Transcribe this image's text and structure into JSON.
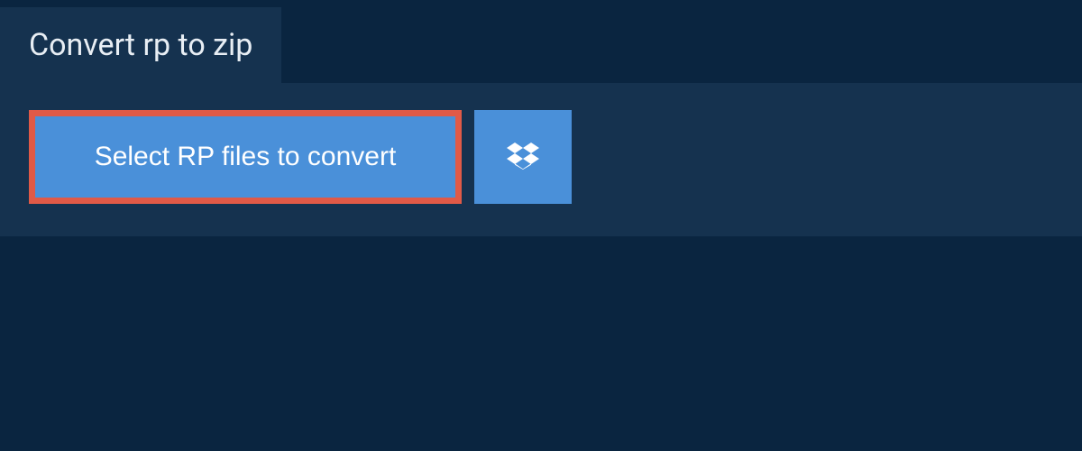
{
  "header": {
    "title": "Convert rp to zip"
  },
  "actions": {
    "select_files_label": "Select RP files to convert",
    "dropbox_icon": "dropbox-icon"
  },
  "colors": {
    "page_bg": "#0a2540",
    "panel_bg": "#15324f",
    "button_bg": "#4a90d9",
    "button_border_highlight": "#e05a47",
    "text_light": "#ffffff"
  }
}
